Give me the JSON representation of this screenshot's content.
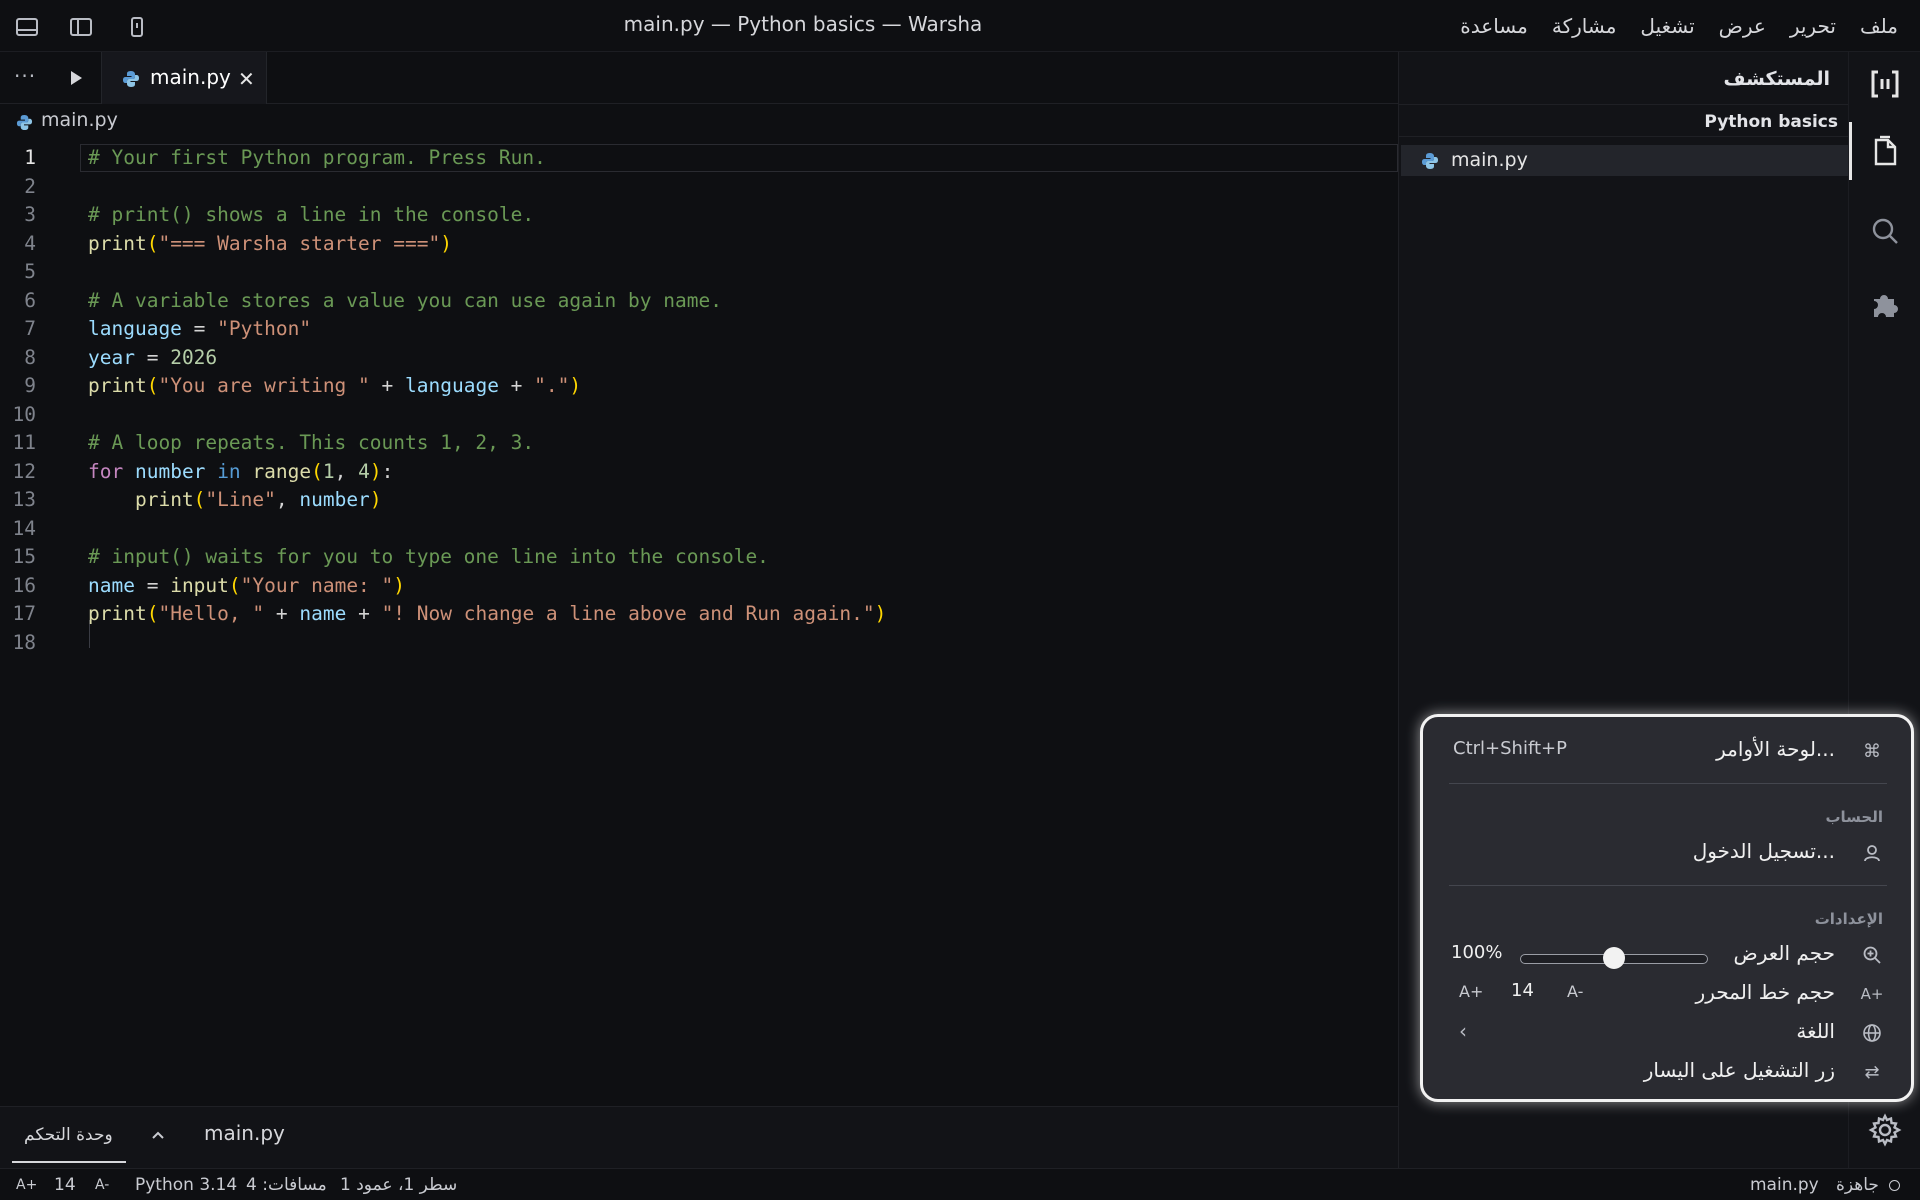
{
  "window": {
    "title": "main.py — Python basics — Warsha"
  },
  "menu": [
    "ملف",
    "تحرير",
    "عرض",
    "تشغيل",
    "مشاركة",
    "مساعدة"
  ],
  "sidebar": {
    "title": "المستكشف",
    "project": "Python basics",
    "files": [
      "main.py"
    ]
  },
  "tabs": {
    "more": "···",
    "active_tab": "main.py",
    "close": "✕"
  },
  "breadcrumb": "main.py",
  "code": {
    "active_line": 1,
    "lines": [
      [
        [
          "comment",
          "# Your first Python program. Press Run."
        ]
      ],
      [],
      [
        [
          "comment",
          "# print() shows a line in the console."
        ]
      ],
      [
        [
          "fn",
          "print"
        ],
        [
          "paren",
          "("
        ],
        [
          "str",
          "\"=== Warsha starter ===\""
        ],
        [
          "paren",
          ")"
        ]
      ],
      [],
      [
        [
          "comment",
          "# A variable stores a value you can use again by name."
        ]
      ],
      [
        [
          "var",
          "language"
        ],
        [
          "plain",
          " = "
        ],
        [
          "str",
          "\"Python\""
        ]
      ],
      [
        [
          "var",
          "year"
        ],
        [
          "plain",
          " = "
        ],
        [
          "num",
          "2026"
        ]
      ],
      [
        [
          "fn",
          "print"
        ],
        [
          "paren",
          "("
        ],
        [
          "str",
          "\"You are writing \""
        ],
        [
          "plain",
          " + "
        ],
        [
          "var",
          "language"
        ],
        [
          "plain",
          " + "
        ],
        [
          "str",
          "\".\""
        ],
        [
          "paren",
          ")"
        ]
      ],
      [],
      [
        [
          "comment",
          "# A loop repeats. This counts 1, 2, 3."
        ]
      ],
      [
        [
          "kw",
          "for"
        ],
        [
          "plain",
          " "
        ],
        [
          "var",
          "number"
        ],
        [
          "plain",
          " "
        ],
        [
          "kw2",
          "in"
        ],
        [
          "plain",
          " "
        ],
        [
          "fn",
          "range"
        ],
        [
          "paren",
          "("
        ],
        [
          "num",
          "1"
        ],
        [
          "plain",
          ", "
        ],
        [
          "num",
          "4"
        ],
        [
          "paren",
          ")"
        ],
        [
          "plain",
          ":"
        ]
      ],
      [
        [
          "plain",
          "    "
        ],
        [
          "fn",
          "print"
        ],
        [
          "paren",
          "("
        ],
        [
          "str",
          "\"Line\""
        ],
        [
          "plain",
          ", "
        ],
        [
          "var",
          "number"
        ],
        [
          "paren",
          ")"
        ]
      ],
      [],
      [
        [
          "comment",
          "# input() waits for you to type one line into the console."
        ]
      ],
      [
        [
          "var",
          "name"
        ],
        [
          "plain",
          " = "
        ],
        [
          "fn",
          "input"
        ],
        [
          "paren",
          "("
        ],
        [
          "str",
          "\"Your name: \""
        ],
        [
          "paren",
          ")"
        ]
      ],
      [
        [
          "fn",
          "print"
        ],
        [
          "paren",
          "("
        ],
        [
          "str",
          "\"Hello, \""
        ],
        [
          "plain",
          " + "
        ],
        [
          "var",
          "name"
        ],
        [
          "plain",
          " + "
        ],
        [
          "str",
          "\"! Now change a line above and Run again.\""
        ],
        [
          "paren",
          ")"
        ]
      ],
      []
    ]
  },
  "panel": {
    "console_tab": "وحدة التحكم",
    "file": "main.py"
  },
  "popup": {
    "command_palette": {
      "label": "لوحة الأوامر...",
      "shortcut": "Ctrl+Shift+P"
    },
    "account_section": "الحساب",
    "sign_in": "تسجيل الدخول...",
    "settings_section": "الإعدادات",
    "zoom": {
      "label": "حجم العرض",
      "value": "100%",
      "level": 0.5
    },
    "editor_font": {
      "label": "حجم خط المحرر",
      "decrease": "A-",
      "value": "14",
      "increase": "A+"
    },
    "language": {
      "label": "اللغة",
      "chevron": "‹"
    },
    "run_left": {
      "label": "زر التشغيل على اليسار"
    }
  },
  "status": {
    "ready": "جاهزة",
    "file": "main.py",
    "position": "سطر 1، عمود 1",
    "spaces": "مسافات: 4",
    "python": "Python 3.14",
    "font_decrease": "A-",
    "font_size": "14",
    "font_increase": "A+"
  },
  "colors": {
    "background": "#0e0f12",
    "comment": "#6a9955",
    "string": "#ce9178",
    "function": "#dcdcaa",
    "variable": "#9cdcfe",
    "keyword": "#c586c0"
  }
}
